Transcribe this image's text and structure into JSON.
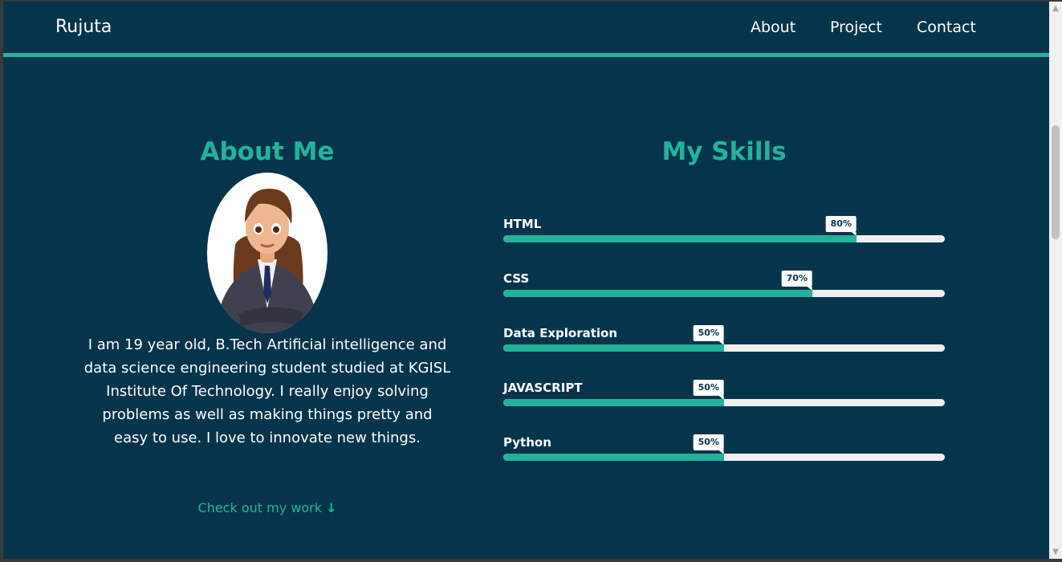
{
  "header": {
    "brand": "Rujuta",
    "nav": [
      "About",
      "Project",
      "Contact"
    ]
  },
  "about": {
    "title": "About Me",
    "text": "I am 19 year old, B.Tech Artificial intelligence and data science engineering student studied at KGISL Institute Of Technology. I really enjoy solving problems as well as making things pretty and easy to use. I love to innovate new things.",
    "cta": "Check out my work",
    "cta_icon": "arrow-down-icon"
  },
  "skills": {
    "title": "My Skills",
    "items": [
      {
        "name": "HTML",
        "percent": 80,
        "label": "80%"
      },
      {
        "name": "CSS",
        "percent": 70,
        "label": "70%"
      },
      {
        "name": "Data Exploration",
        "percent": 50,
        "label": "50%"
      },
      {
        "name": "JAVASCRIPT",
        "percent": 50,
        "label": "50%"
      },
      {
        "name": "Python",
        "percent": 50,
        "label": "50%"
      }
    ]
  },
  "colors": {
    "background": "#06354b",
    "accent": "#22b39a",
    "track": "#efefef",
    "text": "#ffffff"
  }
}
